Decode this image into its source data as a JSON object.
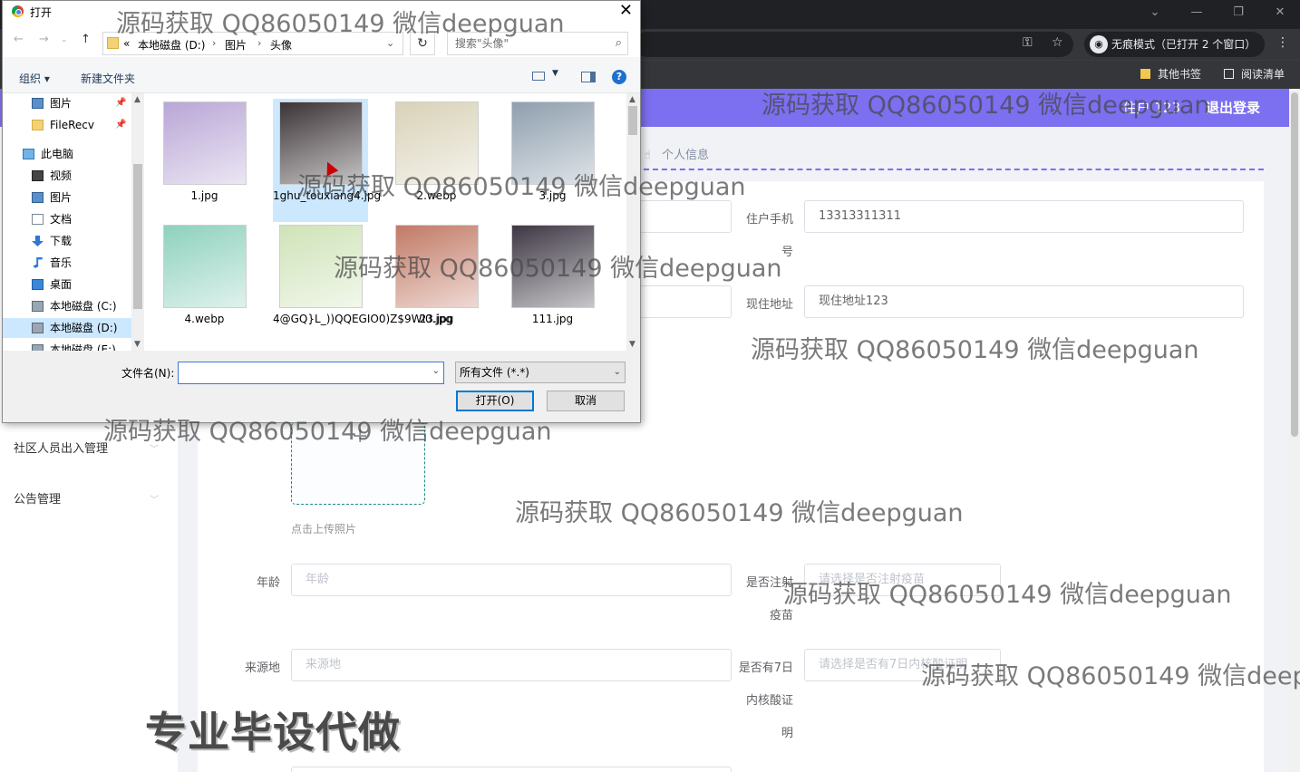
{
  "browser": {
    "incognito_label": "无痕模式（已打开 2 个窗口）",
    "bookmarks": [
      "其他书签",
      "阅读清单"
    ]
  },
  "header": {
    "user": "住户 123",
    "logout": "退出登录"
  },
  "sidebar": {
    "items": [
      "社区人员出入管理",
      "公告管理"
    ]
  },
  "breadcrumb": "个人信息",
  "form": {
    "phone_label_1": "住户手机",
    "phone_label_2": "号",
    "phone_value": "13313311311",
    "addr_label": "现住地址",
    "addr_value": "现住地址123",
    "upload_hint": "点击上传照片",
    "age_label": "年龄",
    "age_placeholder": "年龄",
    "vaccine_label_1": "是否注射",
    "vaccine_label_2": "疫苗",
    "vaccine_placeholder": "请选择是否注射疫苗",
    "origin_label": "来源地",
    "origin_placeholder": "来源地",
    "nat_label_1": "是否有7日",
    "nat_label_2": "内核酸证",
    "nat_label_3": "明",
    "nat_placeholder": "请选择是否有7日内核酸证明"
  },
  "dialog": {
    "title": "打开",
    "breadcrumbs": [
      "«",
      "本地磁盘 (D:)",
      "图片",
      "头像"
    ],
    "search_placeholder": "搜索\"头像\"",
    "organize": "组织 ▾",
    "new_folder": "新建文件夹",
    "nav_items": [
      {
        "label": "图片",
        "icon": "pictures-icon",
        "pin": true
      },
      {
        "label": "FileRecv",
        "icon": "folder-icon",
        "pin": true
      },
      {
        "label": "此电脑",
        "icon": "computer-icon"
      },
      {
        "label": "视频",
        "icon": "video-icon"
      },
      {
        "label": "图片",
        "icon": "pictures-icon"
      },
      {
        "label": "文档",
        "icon": "documents-icon"
      },
      {
        "label": "下载",
        "icon": "download-icon"
      },
      {
        "label": "音乐",
        "icon": "music-icon"
      },
      {
        "label": "桌面",
        "icon": "desktop-icon"
      },
      {
        "label": "本地磁盘 (C:)",
        "icon": "drive-icon"
      },
      {
        "label": "本地磁盘 (D:)",
        "icon": "drive-icon"
      },
      {
        "label": "本地磁盘 (E:)",
        "icon": "drive-icon"
      }
    ],
    "files": [
      {
        "name": "1.jpg",
        "color": "#b9a6d6"
      },
      {
        "name": "1ghu_touxiang4.jpg",
        "color": "#3b3336"
      },
      {
        "name": "2.webp",
        "color": "#d9d2b8"
      },
      {
        "name": "3.jpg",
        "color": "#8e9fae"
      },
      {
        "name": "4.webp",
        "color": "#8ed1bd"
      },
      {
        "name": "4@GQ}L_))QQEGIO0)Z$9WI0.jpg",
        "color": "#cfe3b8"
      },
      {
        "name": "23.jpg",
        "color": "#c27a66"
      },
      {
        "name": "111.jpg",
        "color": "#3d3743"
      }
    ],
    "filename_label": "文件名(N):",
    "filetype": "所有文件 (*.*)",
    "open": "打开(O)",
    "cancel": "取消"
  },
  "watermark": "源码获取 QQ86050149 微信deepguan",
  "stamp": "专业毕设代做"
}
